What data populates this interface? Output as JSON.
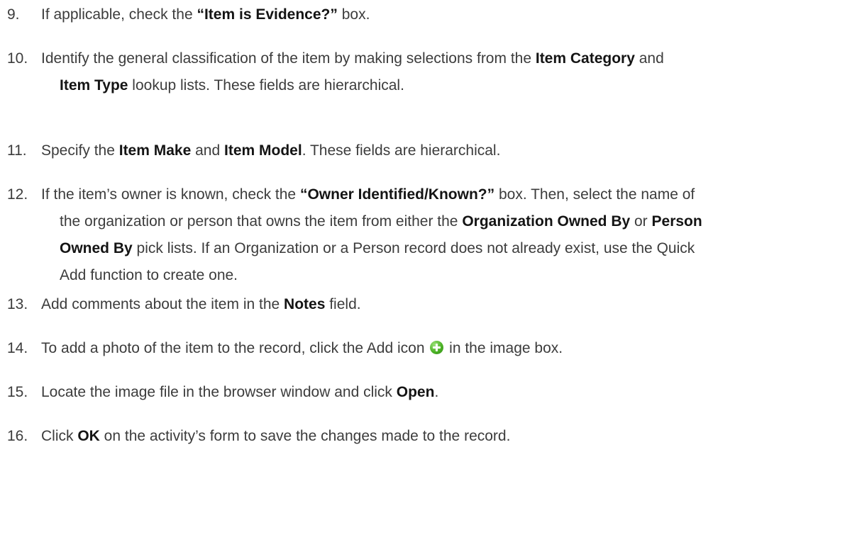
{
  "steps": [
    {
      "number": "9.",
      "lines": [
        [
          "If applicable, check the ",
          {
            "b": "“Item is Evidence?”"
          },
          " box."
        ]
      ]
    },
    {
      "number": "10.",
      "lines": [
        [
          "Identify the general classification of the item by making selections from the ",
          {
            "b": "Item Category"
          },
          " and"
        ],
        [
          {
            "b": "Item Type"
          },
          " lookup lists. These fields are hierarchical."
        ]
      ]
    },
    {
      "number": "11.",
      "lines": [
        [
          "Specify the ",
          {
            "b": "Item Make"
          },
          " and ",
          {
            "b": "Item Model"
          },
          ". These fields are hierarchical."
        ]
      ]
    },
    {
      "number": "12.",
      "lines": [
        [
          "If the item’s owner is known, check the ",
          {
            "b": "“Owner Identified/Known?”"
          },
          " box. Then, select the name of"
        ],
        [
          "the organization or person that owns the item from either the ",
          {
            "b": "Organization Owned By"
          },
          " or ",
          {
            "b": "Person"
          }
        ],
        [
          {
            "b": "Owned By"
          },
          " pick lists. If an Organization or a Person record does not already exist, use the Quick"
        ],
        [
          "Add function to create one."
        ]
      ]
    },
    {
      "number": "13.",
      "lines": [
        [
          "Add comments about the item in the ",
          {
            "b": "Notes"
          },
          " field."
        ]
      ]
    },
    {
      "number": "14.",
      "lines": [
        [
          "To add a photo of the item to the record, click the Add icon ",
          {
            "icon": "add-icon"
          },
          " in the image box."
        ]
      ]
    },
    {
      "number": "15.",
      "lines": [
        [
          "Locate the image file in the browser window and click ",
          {
            "b": "Open"
          },
          "."
        ]
      ]
    },
    {
      "number": "16.",
      "lines": [
        [
          "Click ",
          {
            "b": "OK"
          },
          " on the activity’s form to save the changes made to the record."
        ]
      ]
    }
  ]
}
